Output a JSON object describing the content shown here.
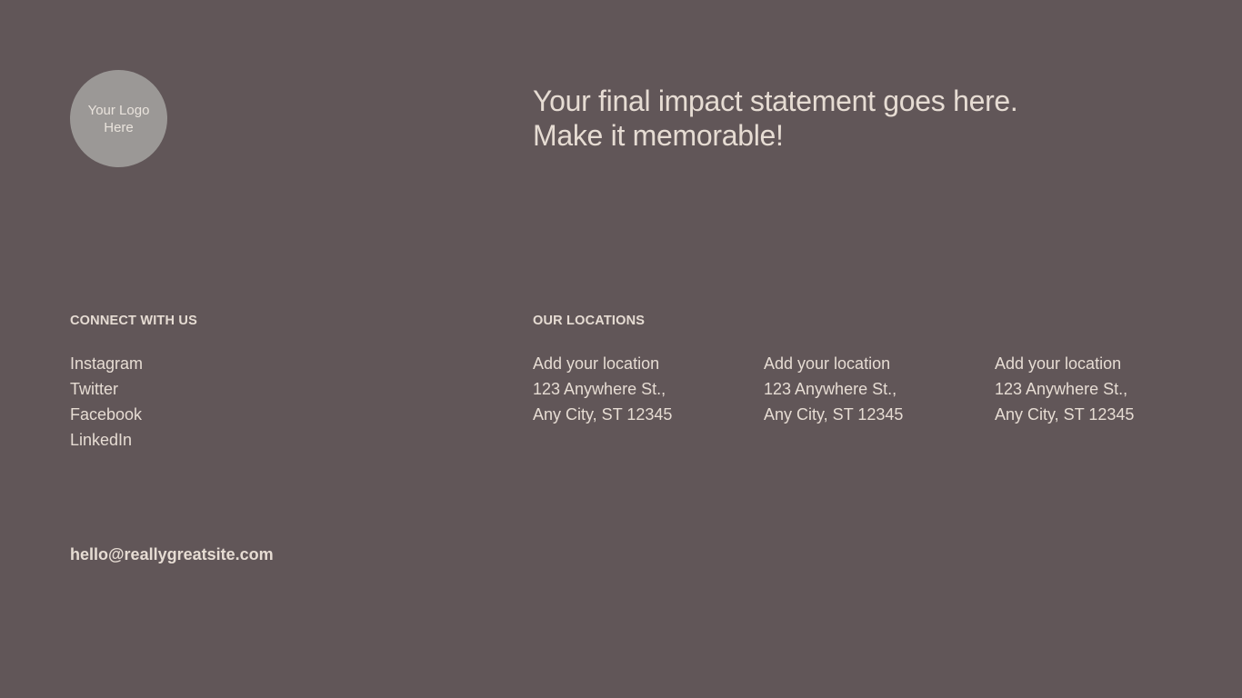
{
  "logo": {
    "text": "Your Logo Here"
  },
  "impact": {
    "line1": "Your final impact statement goes here.",
    "line2": "Make it memorable!"
  },
  "connect": {
    "title": "CONNECT WITH US",
    "links": [
      "Instagram",
      "Twitter",
      "Facebook",
      "LinkedIn"
    ]
  },
  "locations": {
    "title": "OUR LOCATIONS",
    "items": [
      {
        "name": "Add your location",
        "street": "123 Anywhere St.,",
        "city": "Any City, ST 12345"
      },
      {
        "name": "Add your location",
        "street": "123 Anywhere St.,",
        "city": "Any City, ST 12345"
      },
      {
        "name": "Add your location",
        "street": "123 Anywhere St.,",
        "city": "Any City, ST 12345"
      }
    ]
  },
  "contact": {
    "email": "hello@reallygreatsite.com"
  },
  "colors": {
    "background": "#615658",
    "text": "#e6dcd3",
    "logo_circle": "#9b9896"
  }
}
